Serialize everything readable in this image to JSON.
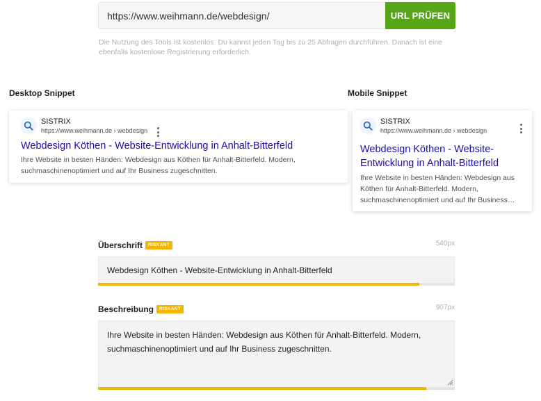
{
  "url_check": {
    "url_value": "https://www.weihmann.de/webdesign/",
    "button_label": "URL PRÜFEN",
    "notice": "Die Nutzung des Tools ist kostenlos. Du kannst jeden Tag bis zu 25 Abfragen durchführen. Danach ist eine ebenfalls kostenlose Registrierung erforderlich."
  },
  "sections": {
    "desktop_title": "Desktop Snippet",
    "mobile_title": "Mobile Snippet"
  },
  "snippet": {
    "site_name": "SISTRIX",
    "site_url": "https://www.weihmann.de › webdesign",
    "title": "Webdesign Köthen - Website-Entwicklung in Anhalt-Bitterfeld",
    "description_desktop": "Ihre Website in besten Händen: Webdesign aus Köthen für Anhalt-Bitterfeld. Modern, suchmaschinenoptimiert und auf Ihr Business zugeschnitten.",
    "description_mobile": "Ihre Website in besten Händen: Webdesign aus Köthen für Anhalt-Bitterfeld. Modern, suchmaschinenoptimiert und auf Ihr Business…"
  },
  "headline_field": {
    "label": "Überschrift",
    "badge": "RISKANT",
    "px_count": "540px",
    "value": "Webdesign Köthen - Website-Entwicklung in Anhalt-Bitterfeld",
    "fill_percent": 90
  },
  "description_field": {
    "label": "Beschreibung",
    "badge": "RISKANT",
    "px_count": "907px",
    "value": "Ihre Website in besten Händen: Webdesign aus Köthen für Anhalt-Bitterfeld. Modern, suchmaschinenoptimiert und auf Ihr Business zugeschnitten.",
    "fill_percent": 92
  },
  "colors": {
    "accent_green": "#56a618",
    "snippet_link": "#1a0dab",
    "warning_badge": "#f2b600"
  },
  "icons": {
    "favicon": "search-icon",
    "menu": "kebab-menu-icon",
    "grip": "resize-grip-icon"
  }
}
